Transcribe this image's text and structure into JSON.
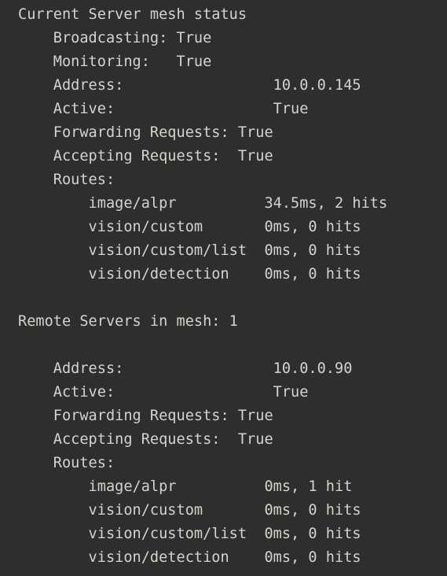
{
  "terminal": {
    "background_color": "#2e2e2e",
    "text_color": "#d6d3cd",
    "current_server": {
      "header": "Current Server mesh status",
      "fields": [
        {
          "label": "Broadcasting:",
          "value": "True"
        },
        {
          "label": "Monitoring:",
          "value": "True"
        },
        {
          "label": "Address:",
          "value": "10.0.0.145"
        },
        {
          "label": "Active:",
          "value": "True"
        },
        {
          "label": "Forwarding Requests:",
          "value": "True"
        },
        {
          "label": "Accepting Requests:",
          "value": "True"
        }
      ],
      "routes_label": "Routes:",
      "routes": [
        {
          "name": "image/alpr",
          "value": "34.5ms, 2 hits"
        },
        {
          "name": "vision/custom",
          "value": "0ms, 0 hits"
        },
        {
          "name": "vision/custom/list",
          "value": "0ms, 0 hits"
        },
        {
          "name": "vision/detection",
          "value": "0ms, 0 hits"
        }
      ]
    },
    "remote_servers": {
      "header": "Remote Servers in mesh: 1",
      "servers": [
        {
          "fields": [
            {
              "label": "Address:",
              "value": "10.0.0.90"
            },
            {
              "label": "Active:",
              "value": "True"
            },
            {
              "label": "Forwarding Requests:",
              "value": "True"
            },
            {
              "label": "Accepting Requests:",
              "value": "True"
            }
          ],
          "routes_label": "Routes:",
          "routes": [
            {
              "name": "image/alpr",
              "value": "0ms, 1 hit"
            },
            {
              "name": "vision/custom",
              "value": "0ms, 0 hits"
            },
            {
              "name": "vision/custom/list",
              "value": "0ms, 0 hits"
            },
            {
              "name": "vision/detection",
              "value": "0ms, 0 hits"
            }
          ]
        }
      ]
    },
    "lines": [
      "Current Server mesh status",
      "    Broadcasting: True",
      "    Monitoring:   True",
      "    Address:                 10.0.0.145",
      "    Active:                  True",
      "    Forwarding Requests: True",
      "    Accepting Requests:  True",
      "    Routes:",
      "        image/alpr          34.5ms, 2 hits",
      "        vision/custom       0ms, 0 hits",
      "        vision/custom/list  0ms, 0 hits",
      "        vision/detection    0ms, 0 hits",
      "",
      "Remote Servers in mesh: 1",
      "",
      "    Address:                 10.0.0.90",
      "    Active:                  True",
      "    Forwarding Requests: True",
      "    Accepting Requests:  True",
      "    Routes:",
      "        image/alpr          0ms, 1 hit",
      "        vision/custom       0ms, 0 hits",
      "        vision/custom/list  0ms, 0 hits",
      "        vision/detection    0ms, 0 hits"
    ]
  }
}
